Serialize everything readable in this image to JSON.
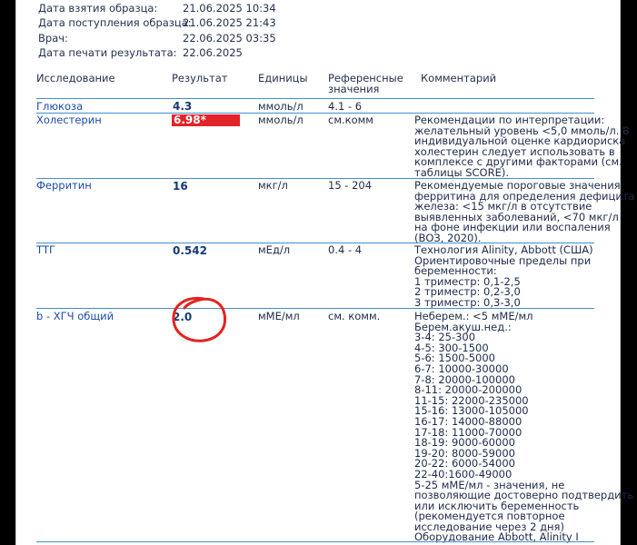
{
  "meta": [
    {
      "label": "Дата взятия образца:",
      "value": "21.06.2025 10:34"
    },
    {
      "label": "Дата поступления образца:",
      "value": "21.06.2025 21:43"
    },
    {
      "label": "Врач:",
      "value": "22.06.2025 03:35"
    },
    {
      "label": "Дата печати результата:",
      "value": "22.06.2025"
    }
  ],
  "columns": {
    "study": "Исследование",
    "result": "Результат",
    "units": "Единицы",
    "ref_line1": "Референсные",
    "ref_line2": "значения",
    "comment": "Комментарий"
  },
  "rows": [
    {
      "name": "Глюкоза",
      "result": "4.3",
      "units": "ммоль/л",
      "ref": "4.1 - 6",
      "comment": ""
    },
    {
      "name": "Холестерин",
      "result": "6.98*",
      "units": "ммоль/л",
      "ref": "см.комм",
      "flag": "#e2232a",
      "comment": "Рекомендации по интерпретации:\nжелательный уровень <5,0 ммоль/л. В\nиндивидуальной оценке кардиориска\nхолестерин следует использовать в\nкомплексе с другими факторами (см.\nтаблицы SCORE)."
    },
    {
      "name": "Ферритин",
      "result": "16",
      "units": "мкг/л",
      "ref": "15 - 204",
      "comment": "Рекомендуемые пороговые значения\nферритина для определения дефицита\nжелеза: <15 мкг/л в отсутствие\nвыявленных заболеваний, <70 мкг/л\nна фоне инфекции или воспаления\n(ВОЗ, 2020)."
    },
    {
      "name": "ТТГ",
      "result": "0.542",
      "units": "мЕд/л",
      "ref": "0.4 - 4",
      "comment": "Технология Alinity, Abbott (США)\nОриентировочные пределы при\nбеременности:\n1 триместр: 0,1-2,5\n2 триместр: 0,2-3,0\n3 триместр: 0,3-3,0"
    },
    {
      "name": "b - ХГЧ общий",
      "result": "2.0",
      "units": "мМЕ/мл",
      "ref": "см. комм.",
      "comment": "Неберем.: <5 мМЕ/мл\nБерем.акуш.нед.:\n3-4: 25-300\n4-5: 300-1500\n5-6: 1500-5000\n6-7: 10000-30000\n7-8: 20000-100000\n8-11: 20000-200000\n11-15: 22000-235000\n15-16: 13000-105000\n16-17: 14000-88000\n17-18: 11000-70000\n18-19: 9000-60000\n19-20: 8000-59000\n20-22: 6000-54000\n22-40:1600-49000\n5-25 мМЕ/мл - значения, не\nпозволяющие достоверно подтвердить\nили исключить беременность\n(рекомендуется повторное\nисследование через 2 дня)\nОборудование Abbott, Alinity I"
    }
  ],
  "colors": {
    "header_rule": "#3f8fd0",
    "test_name": "#1c4aa8",
    "flag_high": "#e2232a",
    "hand_circle": "#e3231f"
  }
}
